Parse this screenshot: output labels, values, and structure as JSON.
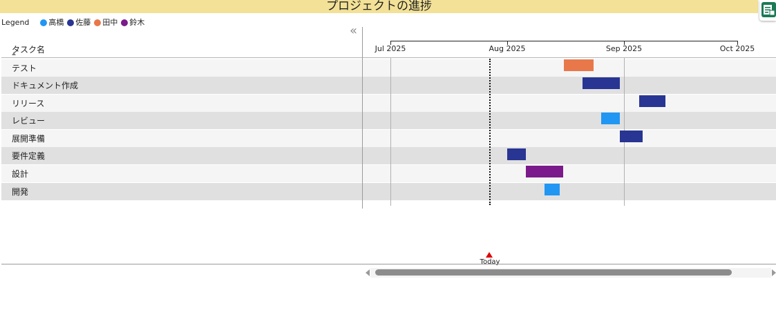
{
  "title": "プロジェクトの進捗",
  "legend": {
    "title": "Legend",
    "items": [
      {
        "name": "高橋",
        "color": "#2196f3"
      },
      {
        "name": "佐藤",
        "color": "#283593"
      },
      {
        "name": "田中",
        "color": "#e8784a"
      },
      {
        "name": "鈴木",
        "color": "#7b1a8a"
      }
    ]
  },
  "task_header": "タスク名",
  "collapse_symbol": "«",
  "timeline": {
    "ticks": [
      "Jul 2025",
      "Aug 2025",
      "Sep 2025",
      "Oct 2025"
    ],
    "today_label": "Today"
  },
  "tasks": [
    {
      "label": "テスト",
      "owner": "田中"
    },
    {
      "label": "ドキュメント作成",
      "owner": "佐藤"
    },
    {
      "label": "リリース",
      "owner": "佐藤"
    },
    {
      "label": "レビュー",
      "owner": "高橋"
    },
    {
      "label": "展開準備",
      "owner": "佐藤"
    },
    {
      "label": "要件定義",
      "owner": "佐藤"
    },
    {
      "label": "設計",
      "owner": "鈴木"
    },
    {
      "label": "開発",
      "owner": "高橋"
    }
  ],
  "icons": {
    "collapse": "double-chevron-left-icon",
    "corner": "report-icon",
    "today_marker": "triangle-up-icon"
  }
}
